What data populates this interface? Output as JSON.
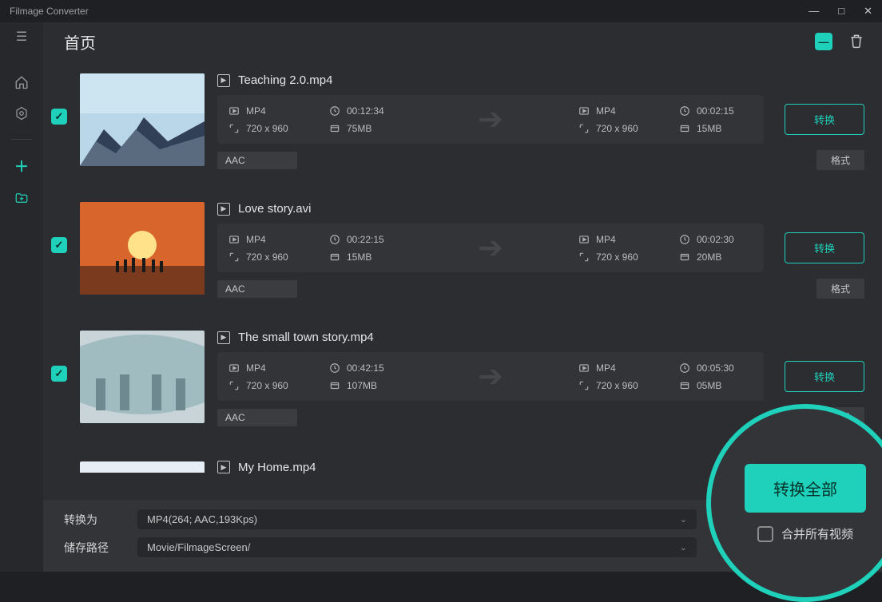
{
  "app": {
    "title": "Filmage Converter"
  },
  "header": {
    "crumb": "首页"
  },
  "items": [
    {
      "name": "Teaching 2.0.mp4",
      "src": {
        "format": "MP4",
        "duration": "00:12:34",
        "resolution": "720 x 960",
        "size": "75MB"
      },
      "dst": {
        "format": "MP4",
        "duration": "00:02:15",
        "resolution": "720 x 960",
        "size": "15MB"
      },
      "audio_tag": "AAC",
      "format_tag": "格式",
      "convert_label": "转换"
    },
    {
      "name": "Love story.avi",
      "src": {
        "format": "MP4",
        "duration": "00:22:15",
        "resolution": "720 x 960",
        "size": "15MB"
      },
      "dst": {
        "format": "MP4",
        "duration": "00:02:30",
        "resolution": "720 x 960",
        "size": "20MB"
      },
      "audio_tag": "AAC",
      "format_tag": "格式",
      "convert_label": "转换"
    },
    {
      "name": "The small town story.mp4",
      "src": {
        "format": "MP4",
        "duration": "00:42:15",
        "resolution": "720 x 960",
        "size": "107MB"
      },
      "dst": {
        "format": "MP4",
        "duration": "00:05:30",
        "resolution": "720 x 960",
        "size": "05MB"
      },
      "audio_tag": "AAC",
      "format_tag": "格式",
      "convert_label": "转换"
    }
  ],
  "peek_item": {
    "name": "My Home.mp4"
  },
  "bottom": {
    "convert_to_label": "转换为",
    "convert_to_value": "MP4(264; AAC,193Kps)",
    "save_path_label": "储存路径",
    "save_path_value": "Movie/FilmageScreen/"
  },
  "highlight": {
    "convert_all_label": "转换全部",
    "merge_label": "合并所有视频"
  }
}
